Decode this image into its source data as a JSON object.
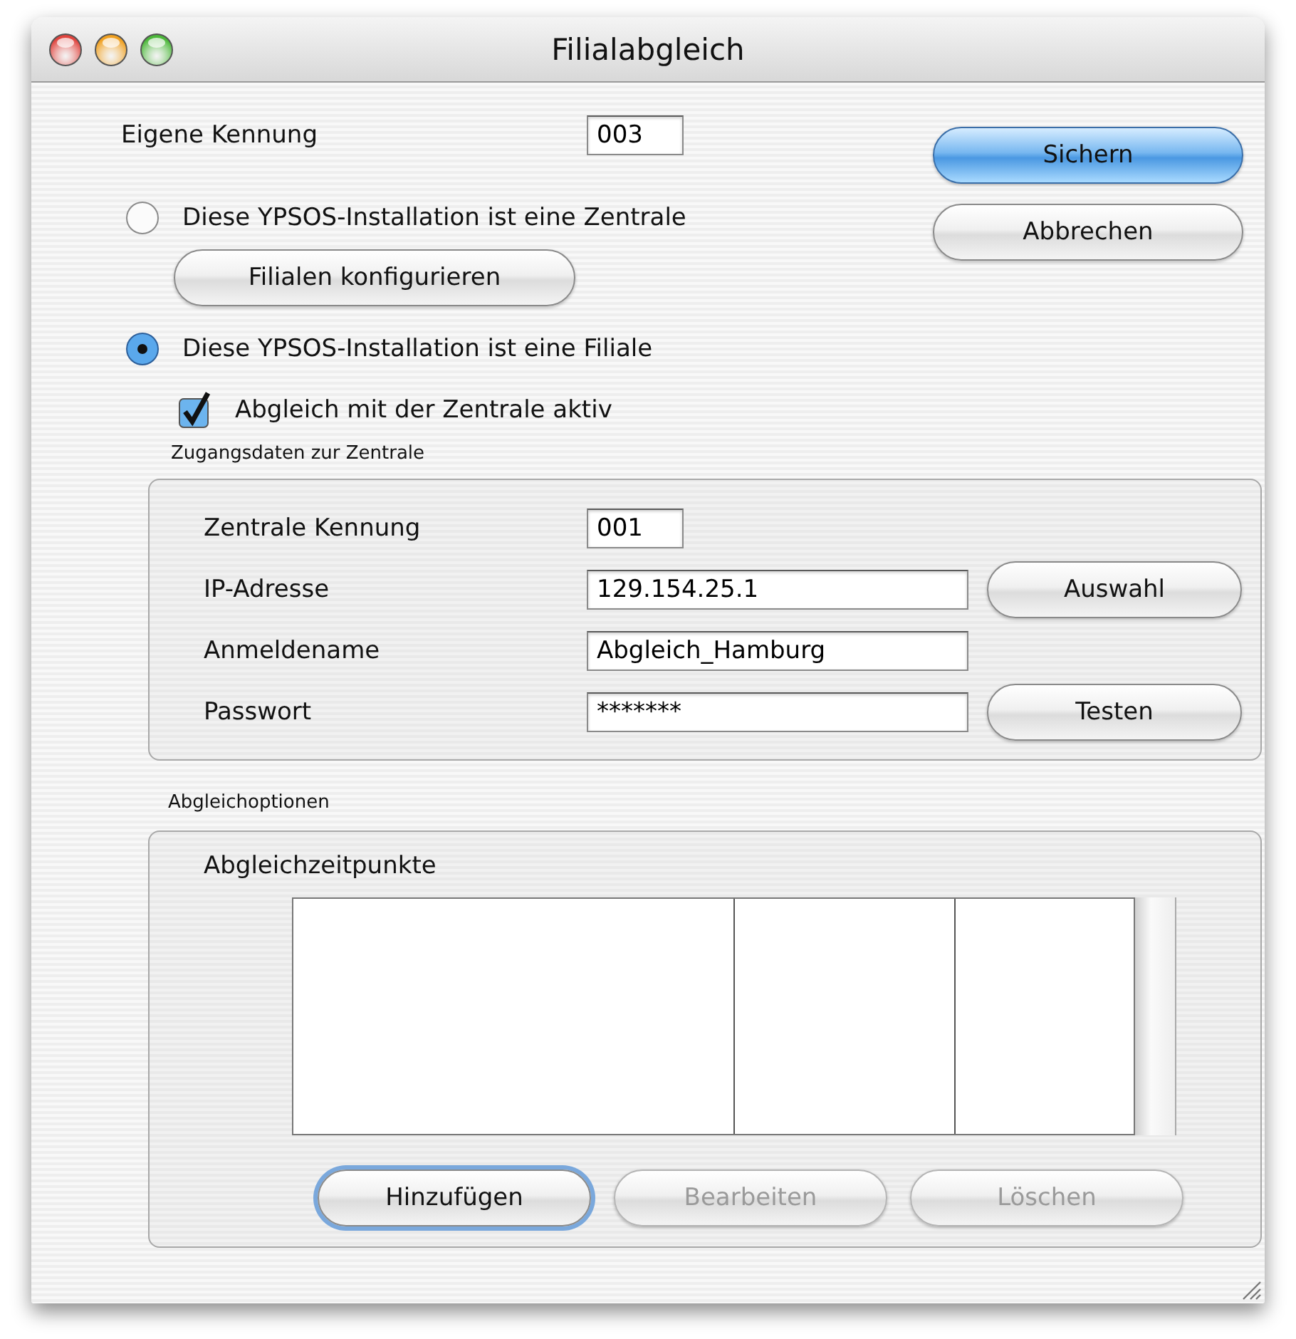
{
  "window": {
    "title": "Filialabgleich"
  },
  "own_id": {
    "label": "Eigene Kennung",
    "value": "003"
  },
  "side_buttons": [
    {
      "label": "Sichern",
      "default": true
    },
    {
      "label": "Abbrechen",
      "default": false
    }
  ],
  "installation_type": [
    {
      "label": "Diese YPSOS-Installation ist eine Zentrale",
      "selected": false,
      "button": "Filialen konfigurieren"
    },
    {
      "label": "Diese YPSOS-Installation ist eine Filiale",
      "selected": true,
      "checkbox": {
        "label": "Abgleich mit der Zentrale aktiv",
        "checked": true
      }
    }
  ],
  "access": {
    "title": "Zugangsdaten zur Zentrale",
    "fields": [
      {
        "label": "Zentrale Kennung",
        "value": "001",
        "kind": "short"
      },
      {
        "label": "IP-Adresse",
        "value": "129.154.25.1",
        "kind": "wide",
        "button": "Auswahl"
      },
      {
        "label": "Anmeldename",
        "value": "Abgleich_Hamburg",
        "kind": "wide"
      },
      {
        "label": "Passwort",
        "value": "*******",
        "kind": "wide",
        "button": "Testen"
      }
    ]
  },
  "options": {
    "title": "Abgleichoptionen",
    "list_title": "Abgleichzeitpunkte",
    "buttons": [
      {
        "label": "Hinzufügen",
        "focused": true,
        "disabled": false
      },
      {
        "label": "Bearbeiten",
        "focused": false,
        "disabled": true
      },
      {
        "label": "Löschen",
        "focused": false,
        "disabled": true
      }
    ]
  }
}
